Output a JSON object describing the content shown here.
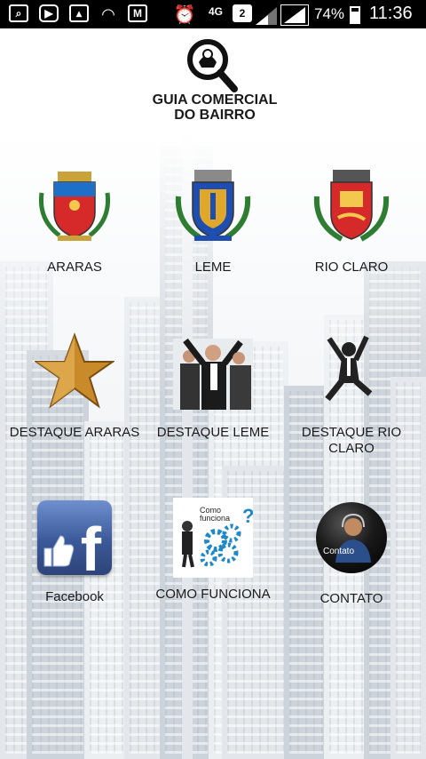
{
  "status_bar": {
    "network": "4G",
    "sim_slot": "2",
    "battery": "74%",
    "time": "11:36"
  },
  "header": {
    "title_line1": "GUIA COMERCIAL",
    "title_line2": "DO BAIRRO"
  },
  "grid": {
    "araras": "ARARAS",
    "leme": "LEME",
    "rio_claro": "RIO CLARO",
    "destaque_araras": "DESTAQUE ARARAS",
    "destaque_leme": "DESTAQUE LEME",
    "destaque_rio_claro": "DESTAQUE RIO CLARO",
    "facebook": "Facebook",
    "como_funciona": "COMO FUNCIONA",
    "contato": "CONTATO"
  },
  "icon_text": {
    "como_funciona_small": "Como funciona",
    "contato_small": "Contato",
    "facebook_letter": "f"
  },
  "colors": {
    "facebook_blue": "#3b5998",
    "star_gold": "#c98b2a",
    "crest_red": "#d62a2a"
  }
}
